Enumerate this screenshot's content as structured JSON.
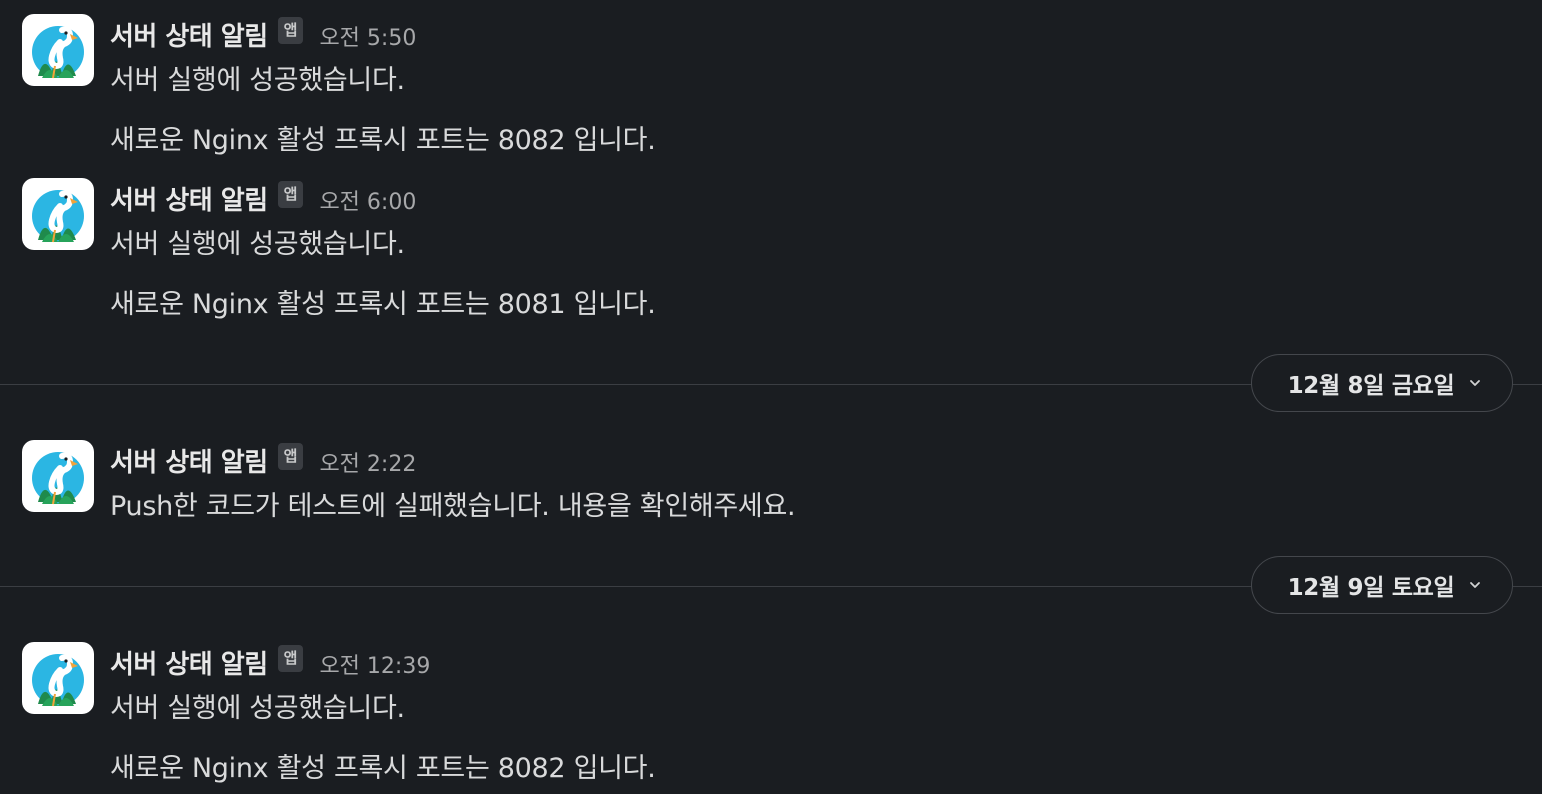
{
  "messages": [
    {
      "sender": "서버 상태 알림",
      "badge": "앱",
      "time": "오전 5:50",
      "lines": [
        "서버 실행에 성공했습니다.",
        "새로운 Nginx 활성 프록시 포트는 8082 입니다."
      ]
    },
    {
      "sender": "서버 상태 알림",
      "badge": "앱",
      "time": "오전 6:00",
      "lines": [
        "서버 실행에 성공했습니다.",
        "새로운 Nginx 활성 프록시 포트는 8081 입니다."
      ]
    },
    {
      "sender": "서버 상태 알림",
      "badge": "앱",
      "time": "오전 2:22",
      "lines": [
        "Push한 코드가 테스트에 실패했습니다. 내용을 확인해주세요."
      ]
    },
    {
      "sender": "서버 상태 알림",
      "badge": "앱",
      "time": "오전 12:39",
      "lines": [
        "서버 실행에 성공했습니다.",
        "새로운 Nginx 활성 프록시 포트는 8082 입니다."
      ]
    }
  ],
  "date_dividers": [
    {
      "label": "12월 8일 금요일",
      "icon": "chevron-down-icon"
    },
    {
      "label": "12월 9일 토요일",
      "icon": "chevron-down-icon"
    }
  ],
  "avatar_icon": "flamingo-icon",
  "colors": {
    "background": "#1a1d21",
    "badge_bg": "#3a3d42",
    "divider": "#3b3e43"
  }
}
